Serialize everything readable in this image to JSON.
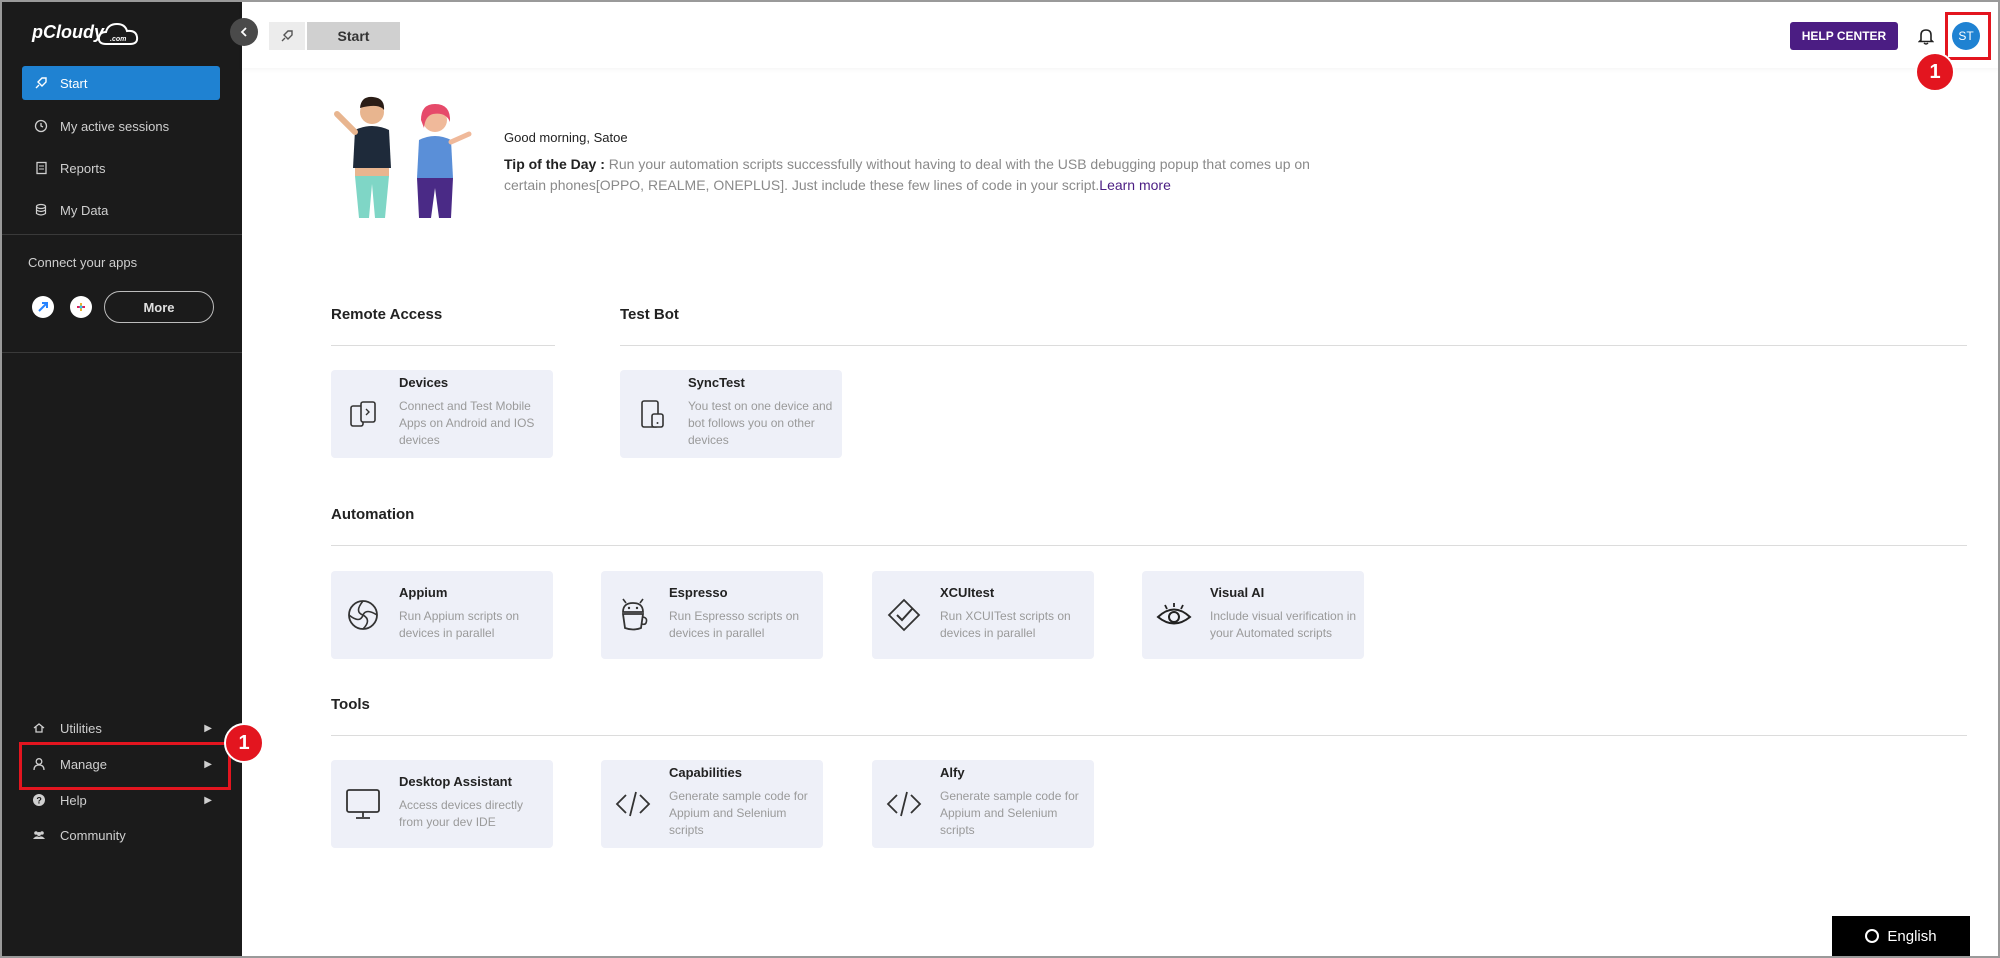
{
  "sidebar": {
    "logo_text": "pCloudy",
    "logo_sub": ".com",
    "nav": [
      {
        "label": "Start",
        "icon": "rocket-icon",
        "active": true
      },
      {
        "label": "My active sessions",
        "icon": "clock-icon"
      },
      {
        "label": "Reports",
        "icon": "report-icon"
      },
      {
        "label": "My Data",
        "icon": "database-icon"
      }
    ],
    "connect_label": "Connect your apps",
    "more_label": "More",
    "bottom": [
      {
        "label": "Utilities",
        "icon": "utilities-icon"
      },
      {
        "label": "Manage",
        "icon": "user-icon"
      },
      {
        "label": "Help",
        "icon": "help-icon"
      },
      {
        "label": "Community",
        "icon": "community-icon"
      }
    ]
  },
  "topbar": {
    "tab_label": "Start",
    "help_center_label": "HELP CENTER",
    "avatar_initials": "ST"
  },
  "annotations": {
    "badge_1": "1",
    "badge_2": "1"
  },
  "main": {
    "greeting": "Good morning, Satoe",
    "tip_label": "Tip of the Day :",
    "tip_text": " Run your automation scripts successfully without having to deal with the USB debugging popup that comes up on certain phones[OPPO, REALME, ONEPLUS]. Just include these few lines of code in your script.",
    "learn_more": "Learn more",
    "sections": {
      "remote_access": "Remote Access",
      "test_bot": "Test Bot",
      "automation": "Automation",
      "tools": "Tools"
    },
    "cards": {
      "devices": {
        "title": "Devices",
        "desc": "Connect and Test Mobile Apps on Android and IOS devices"
      },
      "synctest": {
        "title": "SyncTest",
        "desc": "You test on one device and bot follows you on other devices"
      },
      "appium": {
        "title": "Appium",
        "desc": "Run Appium scripts on devices in parallel"
      },
      "espresso": {
        "title": "Espresso",
        "desc": "Run Espresso scripts on devices in parallel"
      },
      "xcuitest": {
        "title": "XCUItest",
        "desc": "Run XCUITest scripts on devices in parallel"
      },
      "visual_ai": {
        "title": "Visual AI",
        "desc": "Include visual verification in your Automated scripts"
      },
      "desktop_assistant": {
        "title": "Desktop Assistant",
        "desc": "Access devices directly from your dev IDE"
      },
      "capabilities": {
        "title": "Capabilities",
        "desc": "Generate sample code for Appium and Selenium scripts"
      },
      "alfy": {
        "title": "Alfy",
        "desc": "Generate sample code for Appium and Selenium scripts"
      }
    }
  },
  "language_label": "English",
  "colors": {
    "sidebar_bg": "#1b1b1b",
    "active_blue": "#1f82d2",
    "help_purple": "#4b1d83",
    "card_bg": "#eef0f8",
    "highlight_red": "#e3151f"
  }
}
